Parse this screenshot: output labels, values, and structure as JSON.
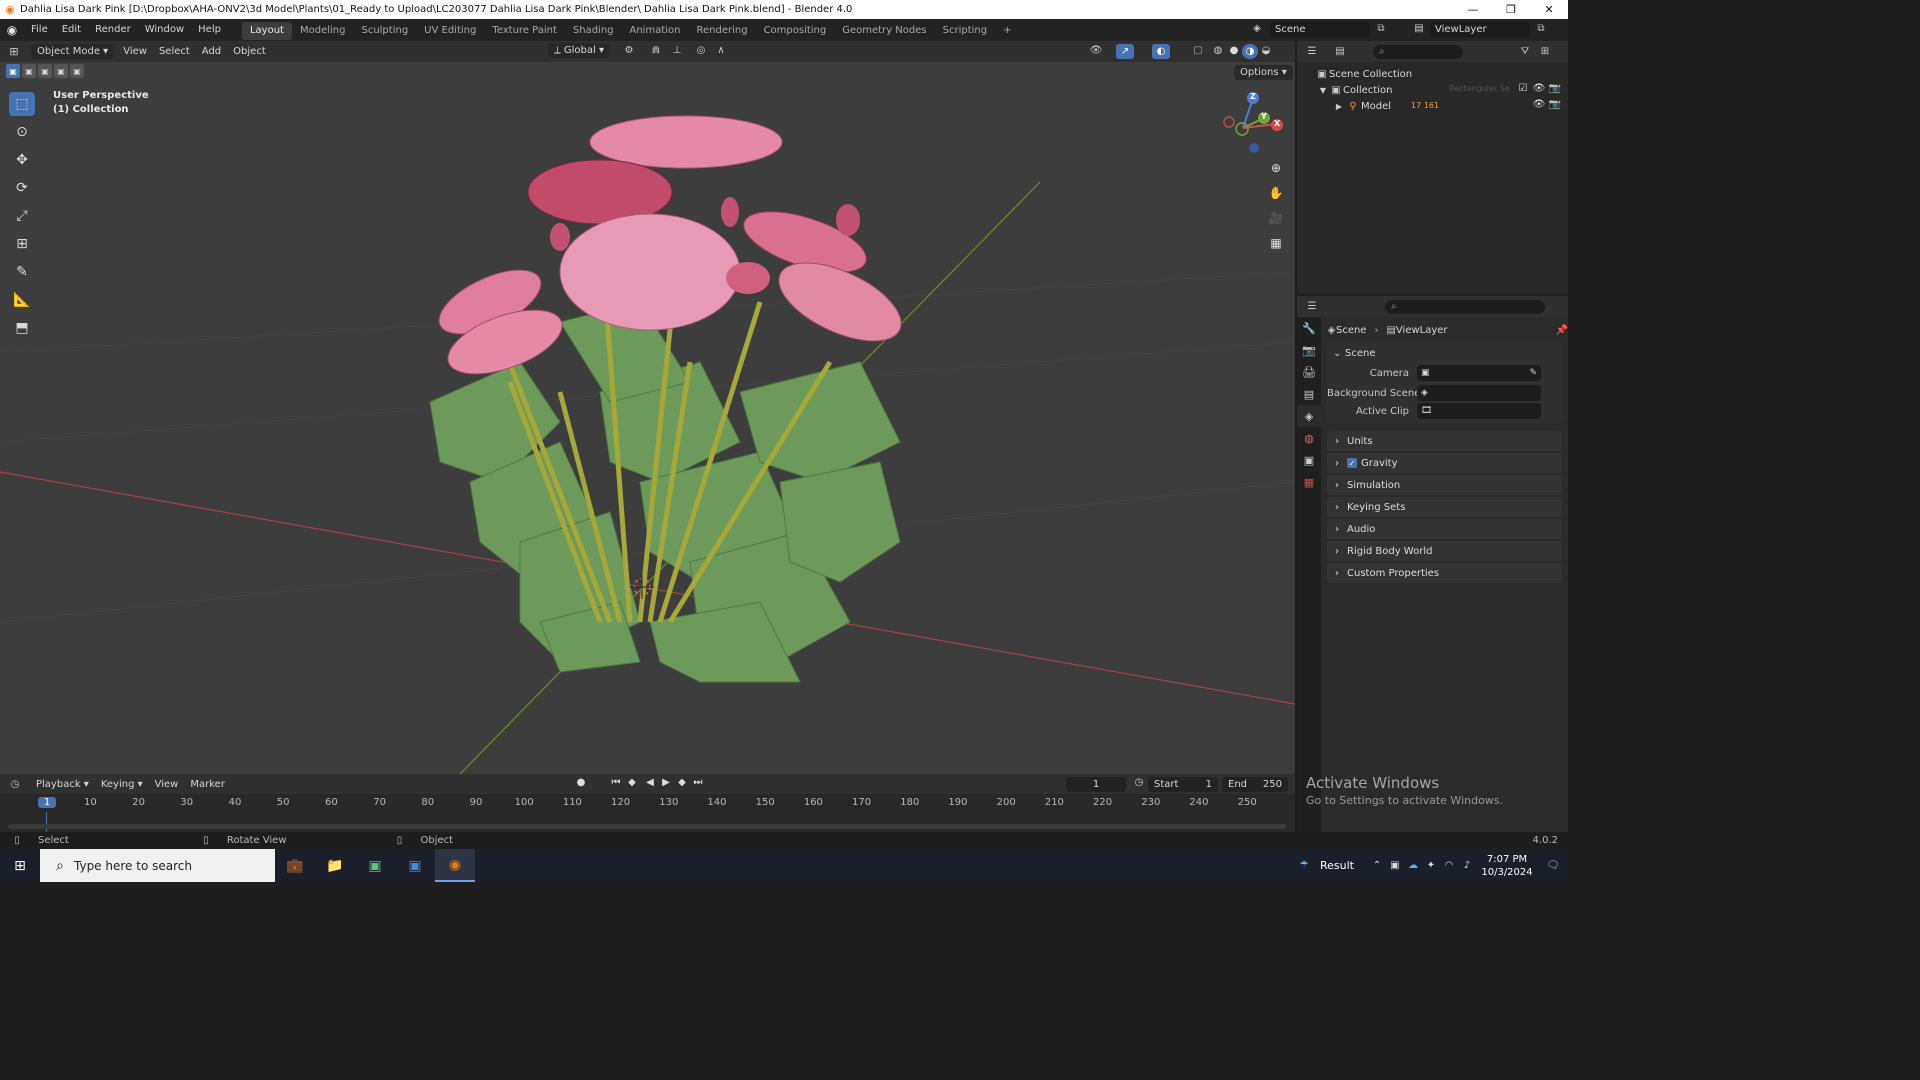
{
  "title_bar": {
    "title": "Dahlia Lisa Dark Pink [D:\\Dropbox\\AHA-ONV2\\3d Model\\Plants\\01_Ready to Upload\\LC203077 Dahlia Lisa Dark Pink\\Blender\\ Dahlia Lisa Dark Pink.blend] - Blender 4.0"
  },
  "menu": [
    "File",
    "Edit",
    "Render",
    "Window",
    "Help"
  ],
  "workspaces": [
    "Layout",
    "Modeling",
    "Sculpting",
    "UV Editing",
    "Texture Paint",
    "Shading",
    "Animation",
    "Rendering",
    "Compositing",
    "Geometry Nodes",
    "Scripting"
  ],
  "scene_selector": "Scene",
  "viewlayer_selector": "ViewLayer",
  "viewport_header": {
    "mode": "Object Mode",
    "menus": [
      "View",
      "Select",
      "Add",
      "Object"
    ],
    "transform_orientation": "Global",
    "options": "Options"
  },
  "viewport": {
    "perspective": "User Perspective",
    "collection": "(1) Collection",
    "gizmo_axes": [
      "Z",
      "Y",
      "X"
    ]
  },
  "outliner": {
    "scene_collection": "Scene Collection",
    "collection": "Collection",
    "model": "Model",
    "model_counts": "17 161",
    "hidden_hint": "Rectangular Se"
  },
  "properties": {
    "breadcrumb_scene": "Scene",
    "breadcrumb_viewlayer": "ViewLayer",
    "scene_panel": "Scene",
    "camera_label": "Camera",
    "background_scene_label": "Background Scene",
    "active_clip_label": "Active Clip",
    "sections": [
      "Units",
      "Gravity",
      "Simulation",
      "Keying Sets",
      "Audio",
      "Rigid Body World",
      "Custom Properties"
    ]
  },
  "timeline": {
    "menus": [
      "Playback",
      "Keying",
      "View",
      "Marker"
    ],
    "current_frame": "1",
    "start_label": "Start",
    "start": "1",
    "end_label": "End",
    "end": "250",
    "ruler": [
      "1",
      "10",
      "20",
      "30",
      "40",
      "50",
      "60",
      "70",
      "80",
      "90",
      "100",
      "110",
      "120",
      "130",
      "140",
      "150",
      "160",
      "170",
      "180",
      "190",
      "200",
      "210",
      "220",
      "230",
      "240",
      "250"
    ]
  },
  "watermark": {
    "title": "Activate Windows",
    "subtitle": "Go to Settings to activate Windows."
  },
  "status_bar": {
    "select": "Select",
    "rotate": "Rotate View",
    "object": "Object",
    "version": "4.0.2"
  },
  "taskbar": {
    "search_placeholder": "Type here to search",
    "result": "Result",
    "time": "7:07 PM",
    "date": "10/3/2024"
  },
  "colors": {
    "viewport_bg": "#3d3d3d",
    "accent": "#4772b3",
    "x_axis": "#b83a3a",
    "y_axis": "#6a8a2a"
  }
}
